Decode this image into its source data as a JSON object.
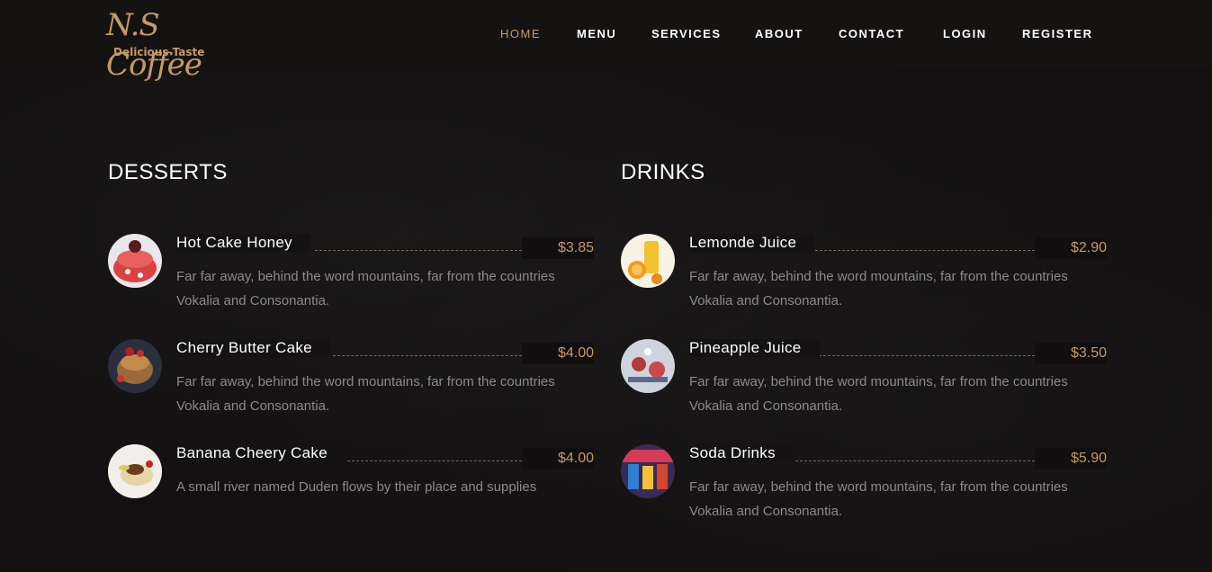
{
  "brand": {
    "logo_main": "N.S Coffee",
    "logo_sub": "Delicious Taste"
  },
  "nav": [
    "HOME",
    "MENU",
    "SERVICES",
    "ABOUT",
    "CONTACT",
    "LOGIN",
    "REGISTER"
  ],
  "sections": {
    "desserts": {
      "title": "DESSERTS",
      "items": [
        {
          "name": "Hot Cake Honey",
          "price": "$3.85",
          "desc": "Far far away, behind the word mountains, far from the countries Vokalia and Consonantia."
        },
        {
          "name": "Cherry Butter Cake",
          "price": "$4.00",
          "desc": "Far far away, behind the word mountains, far from the countries Vokalia and Consonantia."
        },
        {
          "name": "Banana Cheery Cake",
          "price": "$4.00",
          "desc": "A small river named Duden flows by their place and supplies"
        }
      ]
    },
    "drinks": {
      "title": "DRINKS",
      "items": [
        {
          "name": "Lemonde Juice",
          "price": "$2.90",
          "desc": "Far far away, behind the word mountains, far from the countries Vokalia and Consonantia."
        },
        {
          "name": "Pineapple Juice",
          "price": "$3.50",
          "desc": "Far far away, behind the word mountains, far from the countries Vokalia and Consonantia."
        },
        {
          "name": "Soda Drinks",
          "price": "$5.90",
          "desc": "Far far away, behind the word mountains, far from the countries Vokalia and Consonantia."
        }
      ]
    }
  },
  "colors": {
    "accent": "#c49b63",
    "background": "#121010",
    "navbar": "#151212"
  }
}
